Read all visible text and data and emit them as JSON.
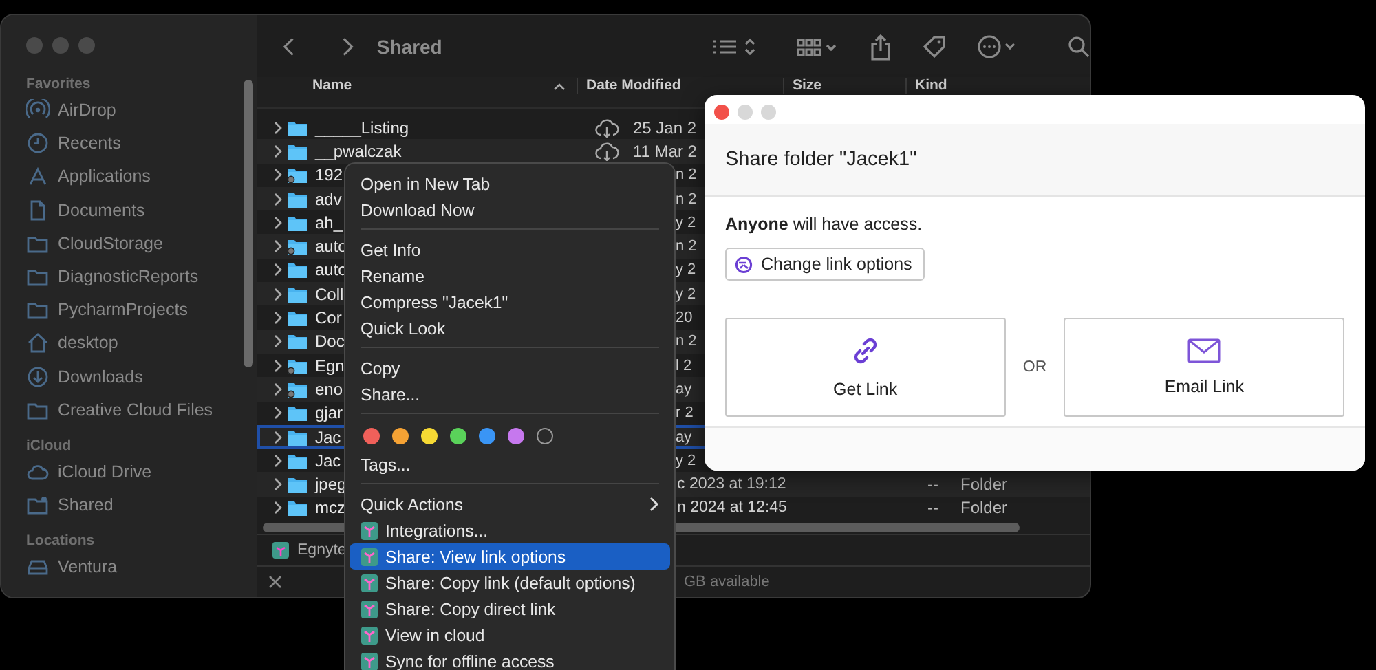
{
  "finder": {
    "title": "Shared",
    "sidebar": [
      {
        "heading": "Favorites",
        "items": [
          {
            "label": "AirDrop"
          },
          {
            "label": "Recents"
          },
          {
            "label": "Applications"
          },
          {
            "label": "Documents"
          },
          {
            "label": "CloudStorage"
          },
          {
            "label": "DiagnosticReports"
          },
          {
            "label": "PycharmProjects"
          },
          {
            "label": "desktop"
          },
          {
            "label": "Downloads"
          },
          {
            "label": "Creative Cloud Files"
          }
        ]
      },
      {
        "heading": "iCloud",
        "items": [
          {
            "label": "iCloud Drive"
          },
          {
            "label": "Shared"
          }
        ]
      },
      {
        "heading": "Locations",
        "items": [
          {
            "label": "Ventura"
          }
        ]
      }
    ],
    "columns": [
      {
        "label": "Name",
        "sorted": true
      },
      {
        "label": "Date Modified",
        "sorted": false
      },
      {
        "label": "Size",
        "sorted": false
      },
      {
        "label": "Kind",
        "sorted": false
      }
    ],
    "rows": [
      {
        "name": "_____Listing",
        "cloud": true,
        "shared": false,
        "date": "25 Jan 2",
        "selected": false
      },
      {
        "name": "__pwalczak",
        "cloud": true,
        "shared": false,
        "date": "11 Mar 2",
        "selected": false
      },
      {
        "name": "192",
        "cloud": false,
        "shared": true,
        "date": "n 2",
        "selected": false
      },
      {
        "name": "adv",
        "cloud": false,
        "shared": false,
        "date": "n 2",
        "selected": false
      },
      {
        "name": "ah_",
        "cloud": false,
        "shared": false,
        "date": "y 2",
        "selected": false
      },
      {
        "name": "auto",
        "cloud": false,
        "shared": true,
        "date": "n 2",
        "selected": false
      },
      {
        "name": "auto",
        "cloud": false,
        "shared": false,
        "date": "y 2",
        "selected": false
      },
      {
        "name": "Coll",
        "cloud": false,
        "shared": false,
        "date": "y 2",
        "selected": false
      },
      {
        "name": "Cor",
        "cloud": false,
        "shared": false,
        "date": "20",
        "selected": false
      },
      {
        "name": "Doc",
        "cloud": false,
        "shared": false,
        "date": "n 2",
        "selected": false
      },
      {
        "name": "Egn",
        "cloud": false,
        "shared": true,
        "date": "l 2",
        "selected": false
      },
      {
        "name": "eno",
        "cloud": false,
        "shared": true,
        "date": "ay",
        "selected": false
      },
      {
        "name": "gjar",
        "cloud": false,
        "shared": false,
        "date": "r 2",
        "selected": false
      },
      {
        "name": "Jac",
        "cloud": false,
        "shared": false,
        "date": "ay",
        "selected": true
      },
      {
        "name": "Jac",
        "cloud": false,
        "shared": false,
        "date": "y 2",
        "selected": false
      },
      {
        "name": "jpeg",
        "cloud": false,
        "shared": false,
        "date": "c 2023 at 19:12",
        "size": "--",
        "kind": "Folder",
        "selected": false
      },
      {
        "name": "mcz",
        "cloud": false,
        "shared": false,
        "date": "n 2024 at 12:45",
        "size": "--",
        "kind": "Folder",
        "selected": false
      }
    ],
    "path": "Egnyte",
    "status": "GB available"
  },
  "menu": [
    {
      "kind": "item",
      "label": "Open in New Tab",
      "selected": false
    },
    {
      "kind": "item",
      "label": "Download Now",
      "selected": false
    },
    {
      "kind": "separator"
    },
    {
      "kind": "item",
      "label": "Get Info",
      "selected": false
    },
    {
      "kind": "item",
      "label": "Rename",
      "selected": false
    },
    {
      "kind": "item",
      "label": "Compress \"Jacek1\"",
      "selected": false
    },
    {
      "kind": "item",
      "label": "Quick Look",
      "selected": false
    },
    {
      "kind": "separator"
    },
    {
      "kind": "item",
      "label": "Copy",
      "selected": false
    },
    {
      "kind": "item",
      "label": "Share...",
      "selected": false
    },
    {
      "kind": "separator"
    },
    {
      "kind": "tags",
      "tags": [
        {
          "kind": "dot",
          "color": "#f0605a"
        },
        {
          "kind": "dot",
          "color": "#f5a234"
        },
        {
          "kind": "dot",
          "color": "#f6d934"
        },
        {
          "kind": "dot",
          "color": "#5ad25a"
        },
        {
          "kind": "dot",
          "color": "#3a95f5"
        },
        {
          "kind": "dot",
          "color": "#c678ee"
        },
        {
          "kind": "empty"
        }
      ]
    },
    {
      "kind": "item",
      "label": "Tags...",
      "selected": false
    },
    {
      "kind": "separator"
    },
    {
      "kind": "submenu",
      "label": "Quick Actions",
      "selected": false
    },
    {
      "kind": "action",
      "label": "Integrations...",
      "selected": false
    },
    {
      "kind": "action",
      "label": "Share: View link options",
      "selected": true
    },
    {
      "kind": "action",
      "label": "Share: Copy link (default options)",
      "selected": false
    },
    {
      "kind": "action",
      "label": "Share: Copy direct link",
      "selected": false
    },
    {
      "kind": "action",
      "label": "View in cloud",
      "selected": false
    },
    {
      "kind": "action",
      "label": "Sync for offline access",
      "selected": false
    }
  ],
  "dialog": {
    "title": "Share folder \"Jacek1\"",
    "access": "**Anyone** will have access.",
    "change_button": "Change link options",
    "options": [
      {
        "label": "Get Link"
      },
      {
        "label": "Email Link"
      }
    ],
    "separator": "OR"
  }
}
